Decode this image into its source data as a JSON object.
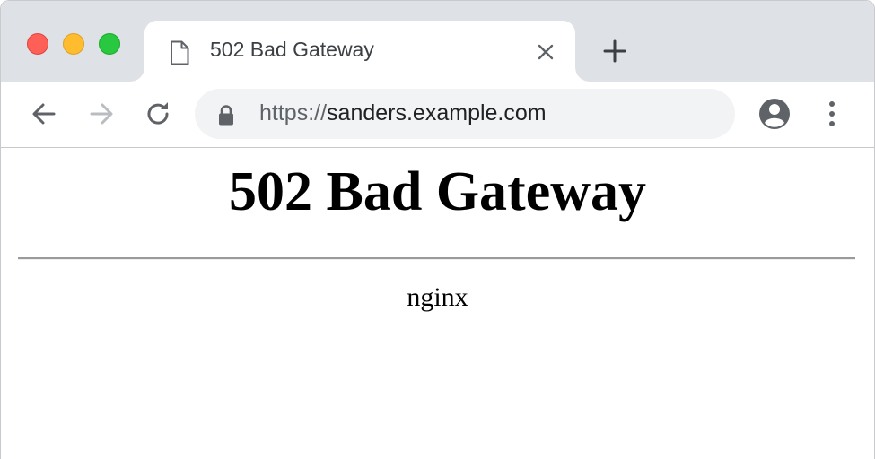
{
  "browser": {
    "tab": {
      "title": "502 Bad Gateway",
      "favicon": "document-icon"
    },
    "address_bar": {
      "scheme": "https://",
      "host": "sanders.example.com"
    },
    "colors": {
      "tabstrip": "#dee1e6",
      "omnibox": "#f1f3f4",
      "close_light": "#fe5f57",
      "minimize_light": "#febc2e",
      "maximize_light": "#28c840"
    }
  },
  "page": {
    "heading": "502 Bad Gateway",
    "server": "nginx"
  }
}
